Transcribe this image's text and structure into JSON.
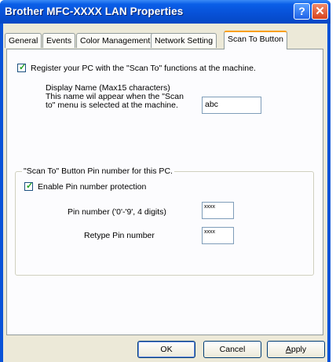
{
  "window": {
    "title": "Brother   MFC-XXXX   LAN Properties",
    "help_glyph": "?",
    "close_glyph": "✕"
  },
  "tabs": [
    {
      "label": "General",
      "active": false
    },
    {
      "label": "Events",
      "active": false
    },
    {
      "label": "Color Management",
      "active": false
    },
    {
      "label": "Network Setting",
      "active": false
    },
    {
      "label": "Scan To Button",
      "active": true
    }
  ],
  "register": {
    "label": "Register your PC with the \"Scan To\" functions at the machine.",
    "checked": true
  },
  "display_name": {
    "line1": "Display Name (Max15 characters)",
    "line2": "This name wil appear when the \"Scan",
    "line3": "to\" menu is selected at the machine.",
    "value": "abc"
  },
  "pin_group": {
    "title": "\"Scan To\" Button Pin number for this PC.",
    "enable_label": "Enable Pin number protection",
    "enable_checked": true,
    "pin_label": "Pin number ('0'-'9', 4 digits)",
    "pin_value": "xxxx",
    "retype_label": "Retype Pin number",
    "retype_value": "xxxx"
  },
  "buttons": {
    "ok": "OK",
    "cancel": "Cancel",
    "apply_first": "A",
    "apply_rest": "pply"
  },
  "colors": {
    "title_blue": "#0750d6",
    "dialog_bg": "#ece9d8",
    "active_tab_accent": "#f9a01a"
  },
  "check_glyph": "✓"
}
